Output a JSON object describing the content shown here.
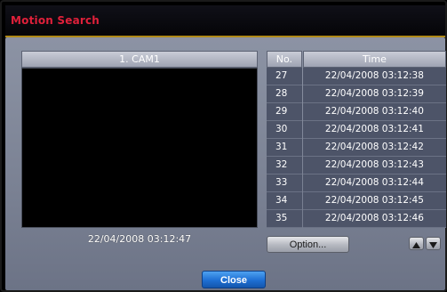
{
  "window": {
    "title": "Motion Search"
  },
  "camera": {
    "label": "1. CAM1",
    "timestamp": "22/04/2008  03:12:47"
  },
  "table": {
    "headers": {
      "no": "No.",
      "time": "Time"
    },
    "rows": [
      {
        "no": "27",
        "time": "22/04/2008  03:12:38"
      },
      {
        "no": "28",
        "time": "22/04/2008  03:12:39"
      },
      {
        "no": "29",
        "time": "22/04/2008  03:12:40"
      },
      {
        "no": "30",
        "time": "22/04/2008  03:12:41"
      },
      {
        "no": "31",
        "time": "22/04/2008  03:12:42"
      },
      {
        "no": "32",
        "time": "22/04/2008  03:12:43"
      },
      {
        "no": "33",
        "time": "22/04/2008  03:12:44"
      },
      {
        "no": "34",
        "time": "22/04/2008  03:12:45"
      },
      {
        "no": "35",
        "time": "22/04/2008  03:12:46"
      }
    ]
  },
  "buttons": {
    "option_label": "Option...",
    "close_label": "Close",
    "scroll_up_icon": "triangle-up-icon",
    "scroll_down_icon": "triangle-down-icon"
  },
  "colors": {
    "title": "#e0203a",
    "accent_line": "#b08a18",
    "close_button": "#1e6fd4"
  }
}
